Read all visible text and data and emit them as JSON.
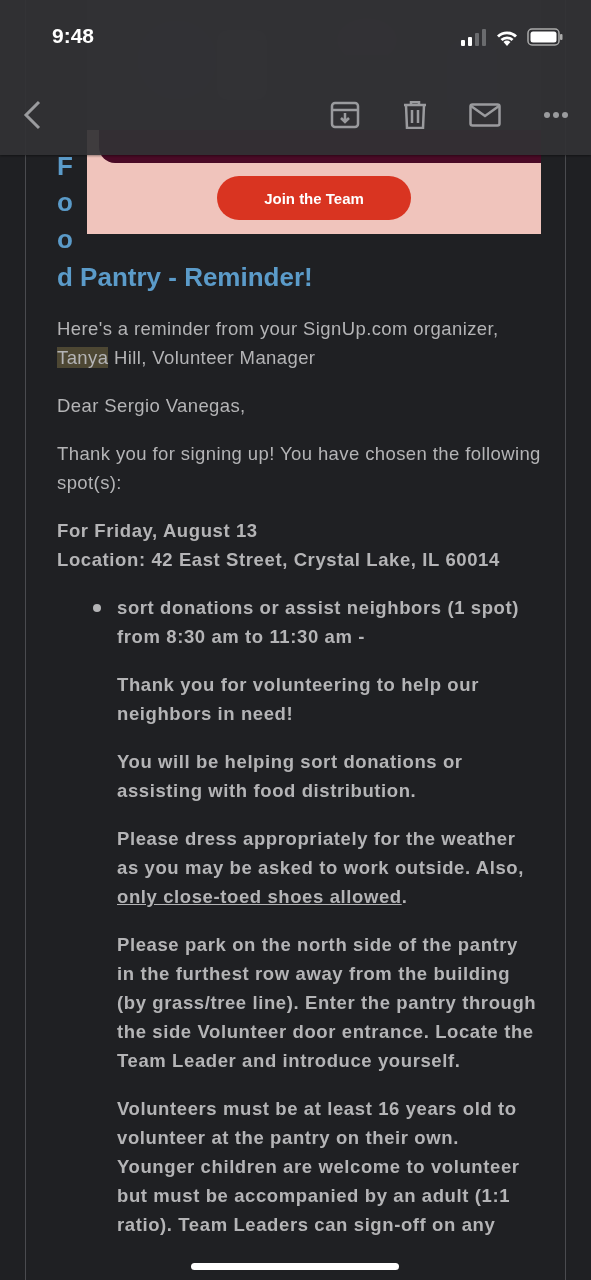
{
  "status_bar": {
    "time": "9:48"
  },
  "banner": {
    "button": "Join the Team"
  },
  "title": {
    "letters": [
      "F",
      "o",
      "o"
    ],
    "tail": "d Pantry - Reminder!"
  },
  "intro": {
    "before": "Here's a reminder from your SignUp.com organizer,",
    "highlight": "Tanya",
    "after": "Hill, Volunteer Manager"
  },
  "greeting": "Dear Sergio Vanegas,",
  "thanks": "Thank you for signing up! You have chosen the following spot(s):",
  "date_line": "For Friday, August 13",
  "location_line": "Location: 42 East Street, Crystal Lake, IL 60014",
  "spot": {
    "name": "sort donations or assist neighbors (1 spot)",
    "time": "from 8:30 am to 11:30 am -"
  },
  "details": [
    {
      "text": "Thank you for volunteering to help our neighbors in need!"
    },
    {
      "text": "You will be helping sort donations or assisting with food distribution."
    },
    {
      "text": "Please dress appropriately for the weather as you may be asked to work outside. Also,",
      "link": "only close-toed shoes allowed",
      "after": "."
    },
    {
      "text": "Please park on the north side of the pantry in the furthest row away from the building (by grass/tree line). Enter the pantry through the side Volunteer door entrance. Locate the Team Leader and introduce yourself."
    },
    {
      "text": "Volunteers must be at least 16 years old to volunteer at the pantry on their own. Younger children are welcome to volunteer but must be accompanied by an adult (1:1 ratio). Team Leaders can sign-off on any"
    }
  ]
}
